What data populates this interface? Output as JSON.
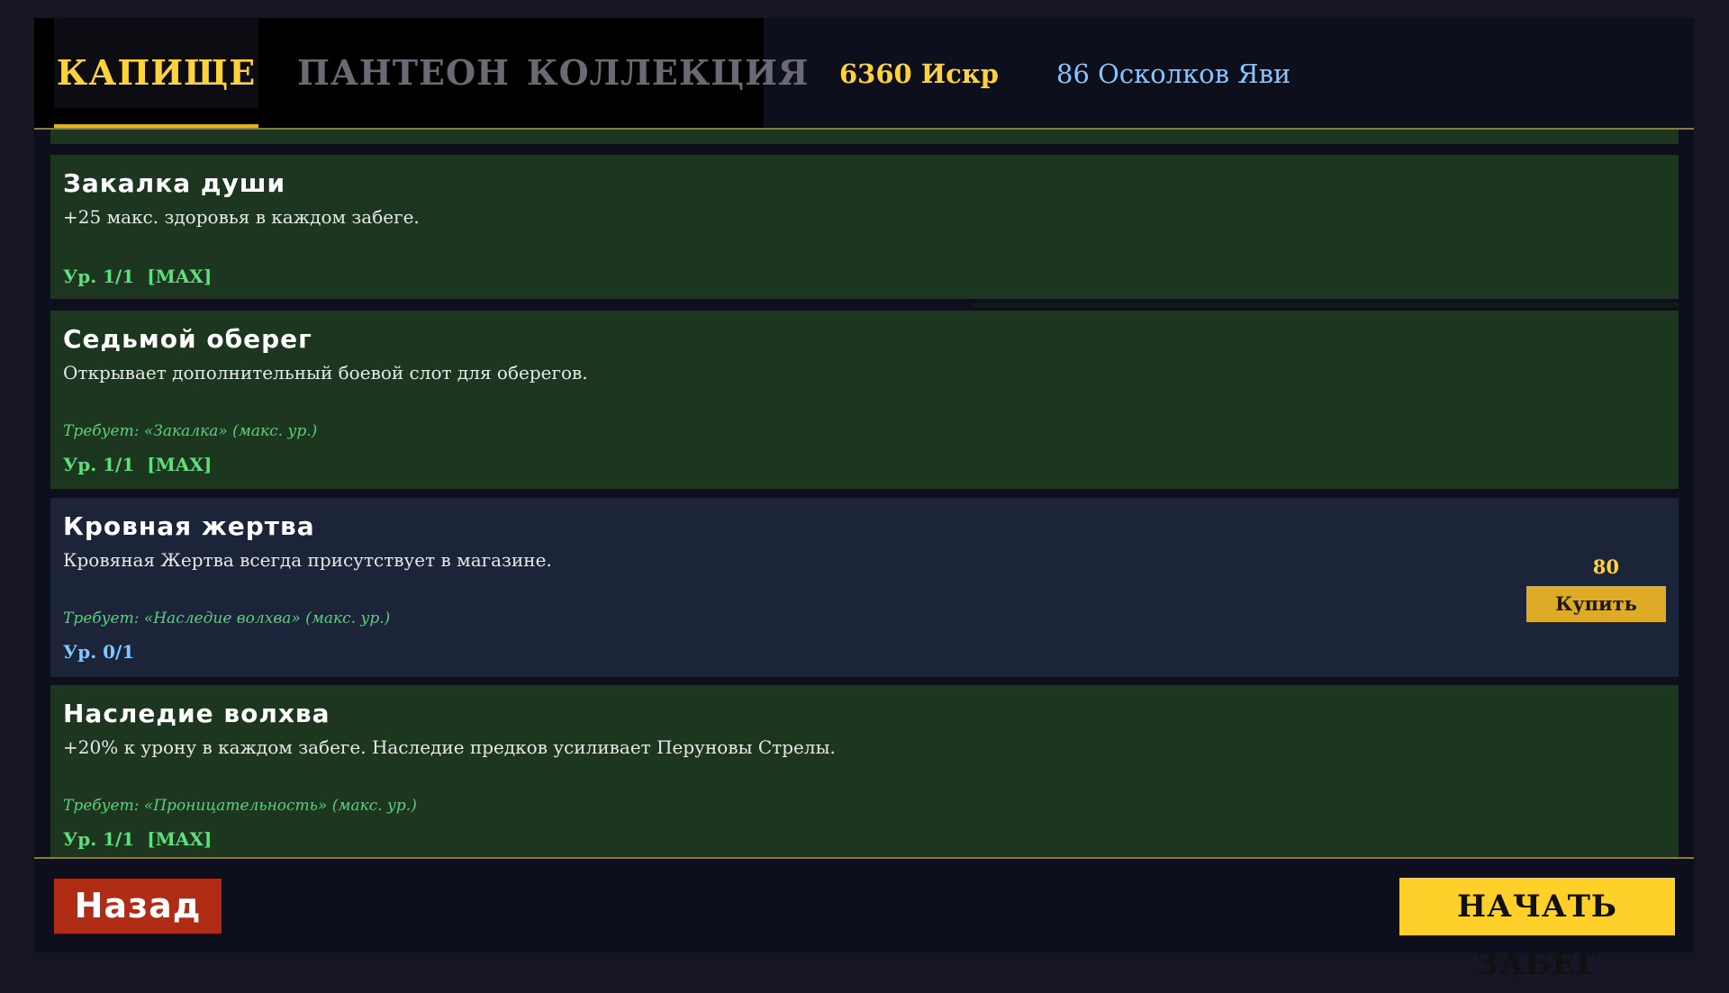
{
  "tabs": [
    {
      "label": "КАПИЩЕ",
      "active": true
    },
    {
      "label": "ПАНТЕОН",
      "active": false
    },
    {
      "label": "КОЛЛЕКЦИЯ",
      "active": false
    }
  ],
  "currency": {
    "sparks": "6360 Искр",
    "shards": "86 Осколков Яви"
  },
  "upgrades": [
    {
      "title": "Закалка души",
      "description": "+25 макс. здоровья в каждом забеге.",
      "requirement": "",
      "level": "Ур. 1/1  [MAX]",
      "maxed": true
    },
    {
      "title": "Седьмой оберег",
      "description": "Открывает дополнительный боевой слот для оберегов.",
      "requirement": "Требует: «Закалка» (макс. ур.)",
      "level": "Ур. 1/1  [MAX]",
      "maxed": true
    },
    {
      "title": "Кровная жертва",
      "description": "Кровяная Жертва всегда присутствует в магазине.",
      "requirement": "Требует: «Наследие волхва» (макс. ур.)",
      "level": "Ур. 0/1",
      "maxed": false,
      "price": "80",
      "buy_label": "Купить"
    },
    {
      "title": "Наследие волхва",
      "description": "+20% к урону в каждом забеге. Наследие предков усиливает Перуновы Стрелы.",
      "requirement": "Требует: «Проницательность» (макс. ур.)",
      "level": "Ур. 1/1  [MAX]",
      "maxed": true
    }
  ],
  "footer": {
    "back_label": "Назад",
    "start_label": "НАЧАТЬ ЗАБЕГ"
  },
  "colors": {
    "accent_gold": "#ffd23c",
    "card_green": "#1d3620",
    "card_blue": "#1b2438",
    "maxed_text": "#5ee07c",
    "open_level_text": "#84c6ff",
    "back_red": "#b02c14"
  }
}
